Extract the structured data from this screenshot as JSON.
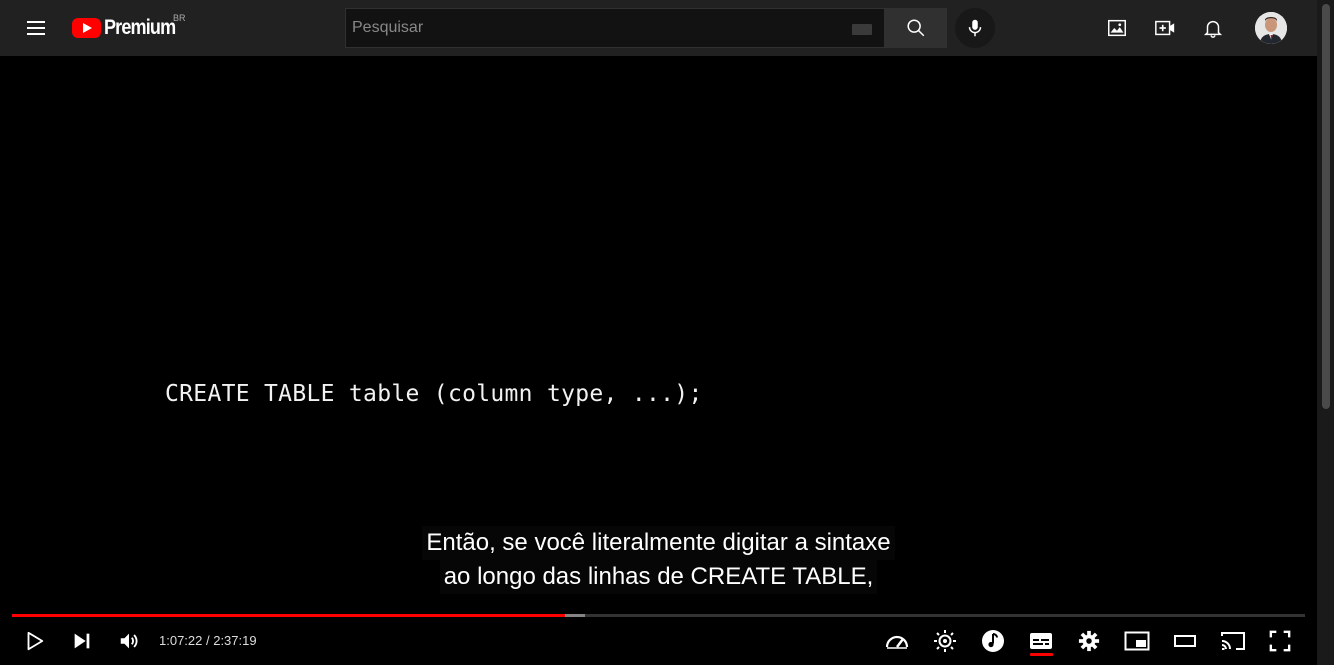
{
  "masthead": {
    "logo_text": "Premium",
    "country_code": "BR",
    "search_placeholder": "Pesquisar"
  },
  "video": {
    "code_text": "CREATE TABLE table (column type, ...);",
    "captions": [
      "Então, se você literalmente digitar a sintaxe",
      "ao longo das linhas de CREATE TABLE,"
    ]
  },
  "player": {
    "time_display": "1:07:22 / 2:37:19",
    "progress_played_fraction": 0.428,
    "progress_loaded_fraction": 0.443,
    "captions_enabled": true
  },
  "colors": {
    "accent": "#ff0000",
    "masthead_bg": "#212121",
    "search_bg": "#121212"
  }
}
